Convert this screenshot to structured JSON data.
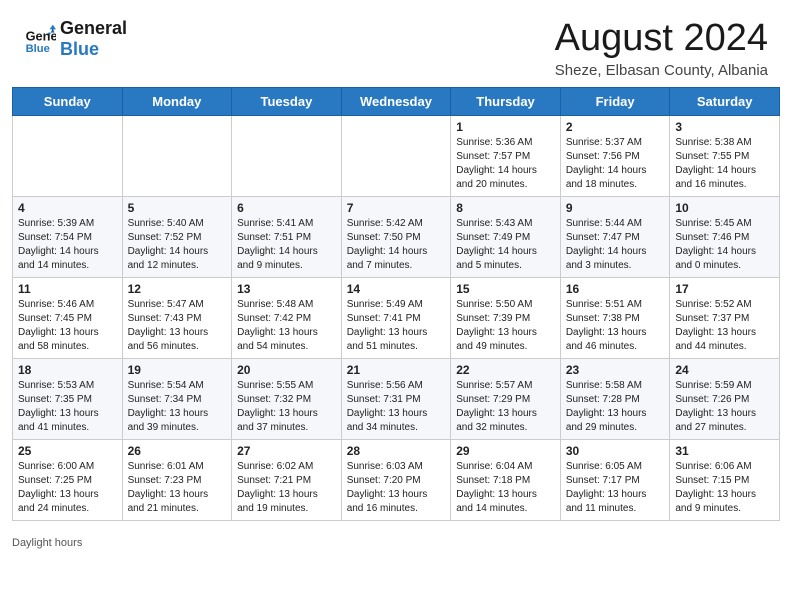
{
  "header": {
    "logo_line1": "General",
    "logo_line2": "Blue",
    "main_title": "August 2024",
    "subtitle": "Sheze, Elbasan County, Albania"
  },
  "days_of_week": [
    "Sunday",
    "Monday",
    "Tuesday",
    "Wednesday",
    "Thursday",
    "Friday",
    "Saturday"
  ],
  "weeks": [
    [
      {
        "day": "",
        "info": ""
      },
      {
        "day": "",
        "info": ""
      },
      {
        "day": "",
        "info": ""
      },
      {
        "day": "",
        "info": ""
      },
      {
        "day": "1",
        "info": "Sunrise: 5:36 AM\nSunset: 7:57 PM\nDaylight: 14 hours\nand 20 minutes."
      },
      {
        "day": "2",
        "info": "Sunrise: 5:37 AM\nSunset: 7:56 PM\nDaylight: 14 hours\nand 18 minutes."
      },
      {
        "day": "3",
        "info": "Sunrise: 5:38 AM\nSunset: 7:55 PM\nDaylight: 14 hours\nand 16 minutes."
      }
    ],
    [
      {
        "day": "4",
        "info": "Sunrise: 5:39 AM\nSunset: 7:54 PM\nDaylight: 14 hours\nand 14 minutes."
      },
      {
        "day": "5",
        "info": "Sunrise: 5:40 AM\nSunset: 7:52 PM\nDaylight: 14 hours\nand 12 minutes."
      },
      {
        "day": "6",
        "info": "Sunrise: 5:41 AM\nSunset: 7:51 PM\nDaylight: 14 hours\nand 9 minutes."
      },
      {
        "day": "7",
        "info": "Sunrise: 5:42 AM\nSunset: 7:50 PM\nDaylight: 14 hours\nand 7 minutes."
      },
      {
        "day": "8",
        "info": "Sunrise: 5:43 AM\nSunset: 7:49 PM\nDaylight: 14 hours\nand 5 minutes."
      },
      {
        "day": "9",
        "info": "Sunrise: 5:44 AM\nSunset: 7:47 PM\nDaylight: 14 hours\nand 3 minutes."
      },
      {
        "day": "10",
        "info": "Sunrise: 5:45 AM\nSunset: 7:46 PM\nDaylight: 14 hours\nand 0 minutes."
      }
    ],
    [
      {
        "day": "11",
        "info": "Sunrise: 5:46 AM\nSunset: 7:45 PM\nDaylight: 13 hours\nand 58 minutes."
      },
      {
        "day": "12",
        "info": "Sunrise: 5:47 AM\nSunset: 7:43 PM\nDaylight: 13 hours\nand 56 minutes."
      },
      {
        "day": "13",
        "info": "Sunrise: 5:48 AM\nSunset: 7:42 PM\nDaylight: 13 hours\nand 54 minutes."
      },
      {
        "day": "14",
        "info": "Sunrise: 5:49 AM\nSunset: 7:41 PM\nDaylight: 13 hours\nand 51 minutes."
      },
      {
        "day": "15",
        "info": "Sunrise: 5:50 AM\nSunset: 7:39 PM\nDaylight: 13 hours\nand 49 minutes."
      },
      {
        "day": "16",
        "info": "Sunrise: 5:51 AM\nSunset: 7:38 PM\nDaylight: 13 hours\nand 46 minutes."
      },
      {
        "day": "17",
        "info": "Sunrise: 5:52 AM\nSunset: 7:37 PM\nDaylight: 13 hours\nand 44 minutes."
      }
    ],
    [
      {
        "day": "18",
        "info": "Sunrise: 5:53 AM\nSunset: 7:35 PM\nDaylight: 13 hours\nand 41 minutes."
      },
      {
        "day": "19",
        "info": "Sunrise: 5:54 AM\nSunset: 7:34 PM\nDaylight: 13 hours\nand 39 minutes."
      },
      {
        "day": "20",
        "info": "Sunrise: 5:55 AM\nSunset: 7:32 PM\nDaylight: 13 hours\nand 37 minutes."
      },
      {
        "day": "21",
        "info": "Sunrise: 5:56 AM\nSunset: 7:31 PM\nDaylight: 13 hours\nand 34 minutes."
      },
      {
        "day": "22",
        "info": "Sunrise: 5:57 AM\nSunset: 7:29 PM\nDaylight: 13 hours\nand 32 minutes."
      },
      {
        "day": "23",
        "info": "Sunrise: 5:58 AM\nSunset: 7:28 PM\nDaylight: 13 hours\nand 29 minutes."
      },
      {
        "day": "24",
        "info": "Sunrise: 5:59 AM\nSunset: 7:26 PM\nDaylight: 13 hours\nand 27 minutes."
      }
    ],
    [
      {
        "day": "25",
        "info": "Sunrise: 6:00 AM\nSunset: 7:25 PM\nDaylight: 13 hours\nand 24 minutes."
      },
      {
        "day": "26",
        "info": "Sunrise: 6:01 AM\nSunset: 7:23 PM\nDaylight: 13 hours\nand 21 minutes."
      },
      {
        "day": "27",
        "info": "Sunrise: 6:02 AM\nSunset: 7:21 PM\nDaylight: 13 hours\nand 19 minutes."
      },
      {
        "day": "28",
        "info": "Sunrise: 6:03 AM\nSunset: 7:20 PM\nDaylight: 13 hours\nand 16 minutes."
      },
      {
        "day": "29",
        "info": "Sunrise: 6:04 AM\nSunset: 7:18 PM\nDaylight: 13 hours\nand 14 minutes."
      },
      {
        "day": "30",
        "info": "Sunrise: 6:05 AM\nSunset: 7:17 PM\nDaylight: 13 hours\nand 11 minutes."
      },
      {
        "day": "31",
        "info": "Sunrise: 6:06 AM\nSunset: 7:15 PM\nDaylight: 13 hours\nand 9 minutes."
      }
    ]
  ],
  "footer": {
    "note": "Daylight hours"
  }
}
